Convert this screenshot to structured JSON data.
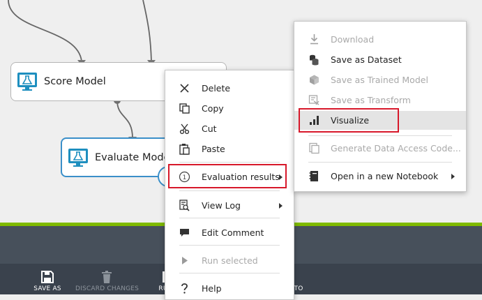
{
  "canvas": {
    "modules": {
      "score": {
        "label": "Score Model",
        "icon": "flask-icon"
      },
      "evaluate": {
        "label": "Evaluate Model",
        "icon": "flask-icon"
      }
    }
  },
  "context_menu": {
    "items": {
      "delete": {
        "label": "Delete",
        "icon": "close-icon"
      },
      "copy": {
        "label": "Copy",
        "icon": "copy-icon"
      },
      "cut": {
        "label": "Cut",
        "icon": "scissors-icon"
      },
      "paste": {
        "label": "Paste",
        "icon": "paste-icon"
      },
      "evaluation_results": {
        "label": "Evaluation results",
        "icon": "port-one-icon",
        "badge": "1",
        "highlighted": true
      },
      "view_log": {
        "label": "View Log",
        "icon": "log-icon"
      },
      "edit_comment": {
        "label": "Edit Comment",
        "icon": "comment-icon"
      },
      "run_selected": {
        "label": "Run selected",
        "icon": "play-icon",
        "disabled": true
      },
      "help": {
        "label": "Help",
        "icon": "question-icon"
      }
    }
  },
  "submenu": {
    "items": {
      "download": {
        "label": "Download",
        "icon": "download-icon",
        "disabled": true
      },
      "save_dataset": {
        "label": "Save as Dataset",
        "icon": "dataset-icon"
      },
      "save_trained_model": {
        "label": "Save as Trained Model",
        "icon": "trained-model-icon",
        "disabled": true
      },
      "save_transform": {
        "label": "Save as Transform",
        "icon": "transform-icon",
        "disabled": true
      },
      "visualize": {
        "label": "Visualize",
        "icon": "bar-chart-icon",
        "hovered": true,
        "highlighted": true
      },
      "generate_code": {
        "label": "Generate Data Access Code...",
        "icon": "code-icon",
        "disabled": true
      },
      "open_notebook": {
        "label": "Open in a new Notebook",
        "icon": "notebook-icon"
      }
    }
  },
  "toolbar": {
    "save_as": {
      "label": "SAVE AS",
      "icon": "save-icon"
    },
    "discard": {
      "label": "DISCARD CHANGES",
      "icon": "trash-icon",
      "disabled": true
    },
    "run_partial": {
      "label": "RU"
    },
    "to_partial": {
      "label": "TO"
    }
  },
  "colors": {
    "accent_blue": "#3a8fc9",
    "highlight_red": "#d7182a",
    "status_green": "#7fba00",
    "toolbar_dark": "#3a424d",
    "menu_hover": "#e4e4e4"
  }
}
